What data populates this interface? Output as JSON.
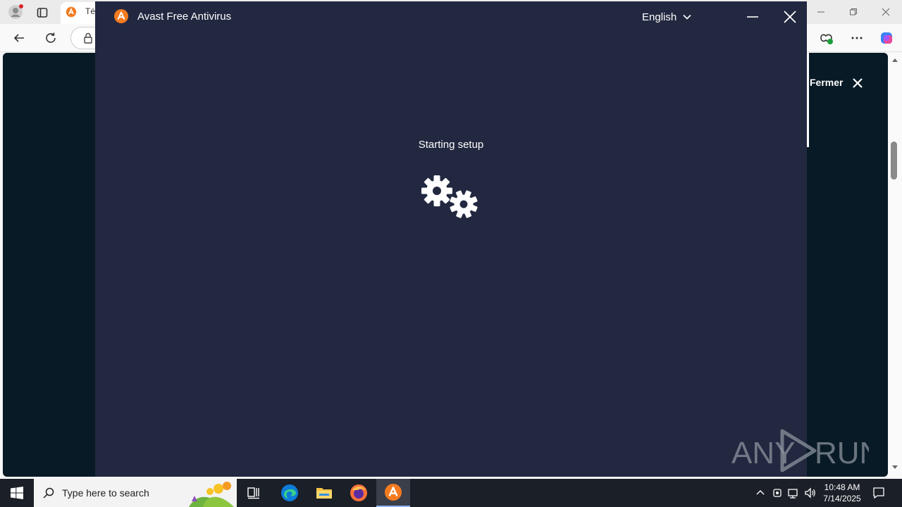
{
  "browser": {
    "tab_title": "Té",
    "page_close_label": "Fermer"
  },
  "installer": {
    "title": "Avast Free Antivirus",
    "language": "English",
    "status": "Starting setup"
  },
  "watermark": {
    "text_left": "ANY",
    "text_right": "RUN"
  },
  "taskbar": {
    "search_placeholder": "Type here to search",
    "time": "10:48 AM",
    "date": "7/14/2025"
  },
  "colors": {
    "installer_bg": "#222840",
    "avast_orange": "#f47b20",
    "page_bg": "#071a25"
  }
}
